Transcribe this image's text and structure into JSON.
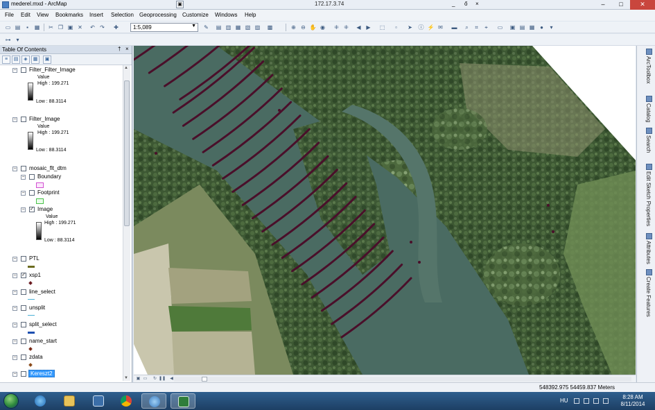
{
  "window": {
    "title": "mederel.mxd - ArcMap",
    "remote_host": "172.17.3.74",
    "remote_controls": [
      "_",
      "ő",
      "×"
    ]
  },
  "menu": [
    "File",
    "Edit",
    "View",
    "Bookmarks",
    "Insert",
    "Selection",
    "Geoprocessing",
    "Customize",
    "Windows",
    "Help"
  ],
  "toolbar": {
    "scale_value": "1:5,089"
  },
  "toc": {
    "title": "Table Of Contents",
    "header_buttons": [
      "†",
      "×"
    ],
    "layers": {
      "filter_filter_image": {
        "name": "Filter_Filter_Image",
        "value_label": "Value",
        "high": "High : 199.271",
        "low": "Low : 88.3114",
        "checked": false
      },
      "filter_image": {
        "name": "Filter_Image",
        "value_label": "Value",
        "high": "High : 199.271",
        "low": "Low : 88.3114",
        "checked": false
      },
      "mosaic": {
        "name": "mosaic_flt_dtm",
        "boundary": "Boundary",
        "footprint": "Footprint",
        "image": "Image",
        "value_label": "Value",
        "high": "High : 199.271",
        "low": "Low : 88.3114"
      },
      "ptl": {
        "name": "PTL",
        "checked": false
      },
      "xsp1": {
        "name": "xsp1",
        "checked": true
      },
      "line_select": {
        "name": "line_select",
        "checked": false
      },
      "unsplit": {
        "name": "unsplit",
        "checked": false
      },
      "split_select": {
        "name": "split_select",
        "checked": false
      },
      "name_start": {
        "name": "name_start",
        "checked": false
      },
      "zdata": {
        "name": "zdata",
        "checked": false
      },
      "kereszt2": {
        "name": "Kereszt2",
        "checked": false
      }
    }
  },
  "right_dock": {
    "tabs": [
      "ArcToolbox",
      "Catalog",
      "Search",
      "Edit Sketch Properties",
      "Attributes",
      "Create Features"
    ]
  },
  "status": {
    "coordinates": "548392.975  54459.837 Meters"
  },
  "taskbar": {
    "language": "HU",
    "time": "8:28 AM",
    "date": "8/11/2014"
  },
  "colors": {
    "profile_line": "#4a0f2a",
    "river": "#4a6b62",
    "forest": "#3f5a34",
    "selection_highlight": "#3399ff"
  }
}
